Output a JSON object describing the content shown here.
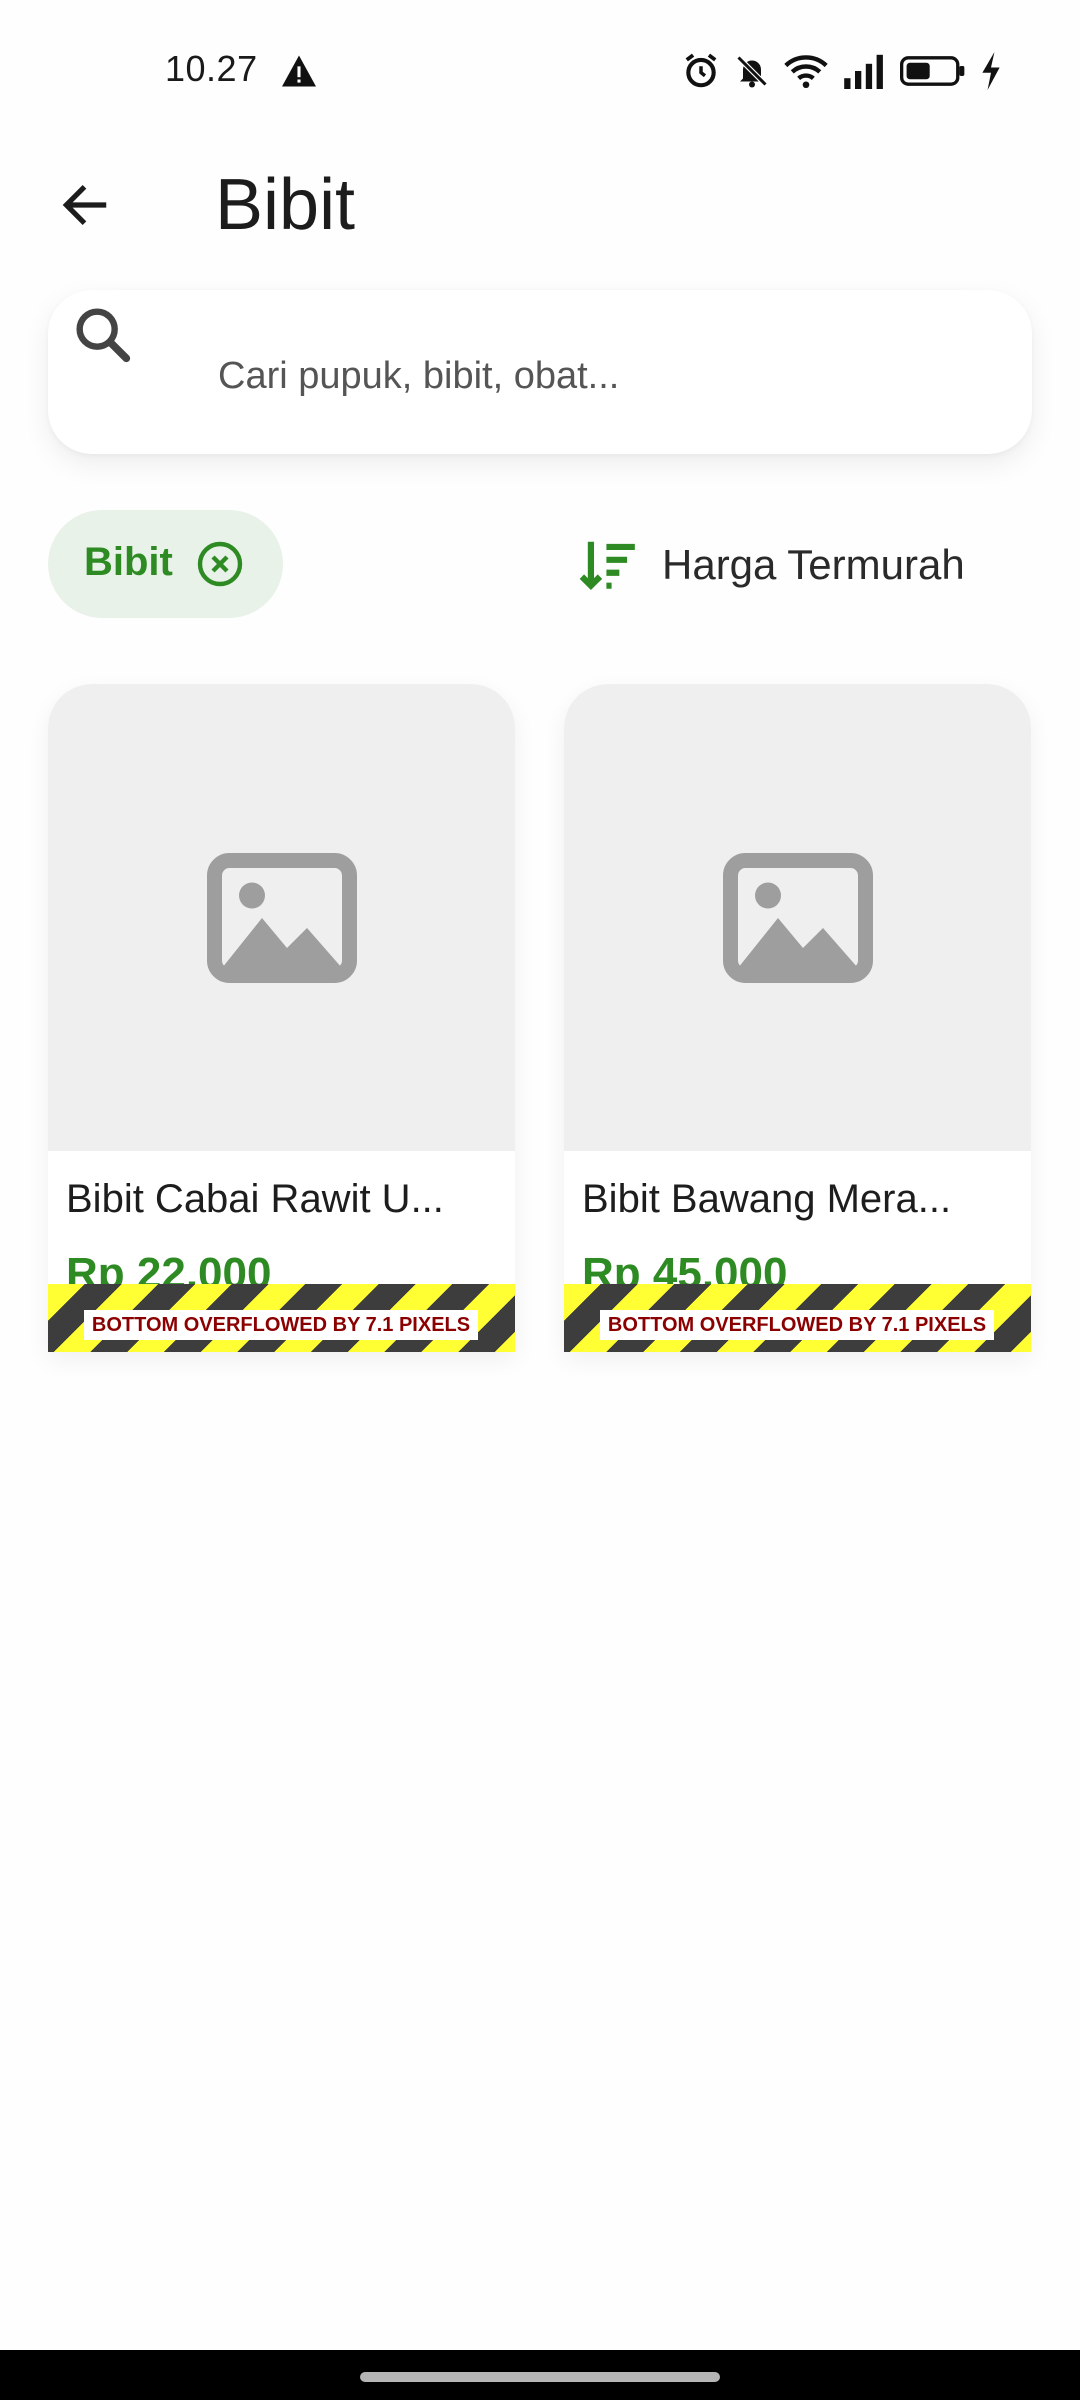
{
  "status_bar": {
    "time": "10.27",
    "icons": [
      "warning-icon",
      "alarm-icon",
      "bell-off-icon",
      "wifi-icon",
      "signal-icon",
      "battery-icon",
      "charging-icon"
    ]
  },
  "app_bar": {
    "title": "Bibit",
    "back_icon": "arrow-left-icon"
  },
  "search": {
    "placeholder": "Cari pupuk, bibit, obat...",
    "value": ""
  },
  "filters": {
    "active_chip": {
      "label": "Bibit"
    },
    "sort": {
      "label": "Harga Termurah"
    }
  },
  "products": [
    {
      "name": "Bibit Cabai Rawit U...",
      "price": "Rp 22.000",
      "overflow_message": "BOTTOM OVERFLOWED BY 7.1 PIXELS"
    },
    {
      "name": "Bibit Bawang Mera...",
      "price": "Rp 45.000",
      "overflow_message": "BOTTOM OVERFLOWED BY 7.1 PIXELS"
    }
  ],
  "colors": {
    "accent_green": "#2e8b23",
    "chip_background": "#e8f2e8",
    "image_placeholder": "#efefef"
  }
}
